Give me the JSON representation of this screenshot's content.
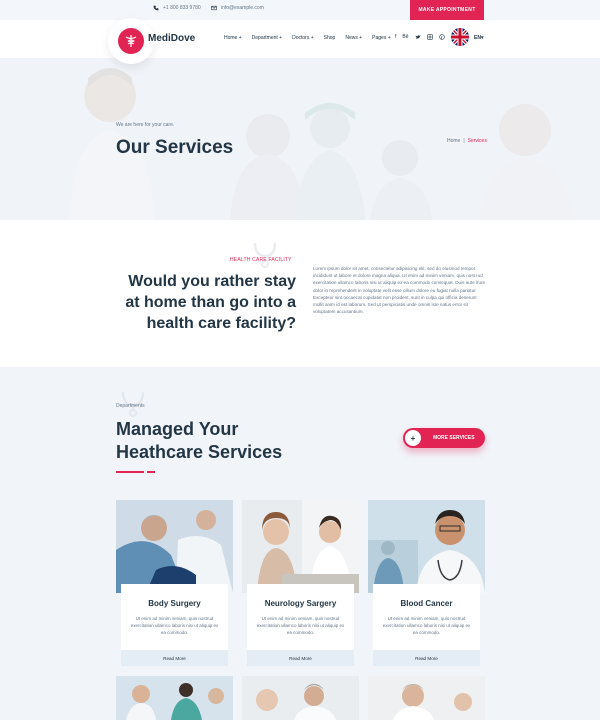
{
  "topbar": {
    "phone": "+1 800 833 9780",
    "email": "info@example.com",
    "appointment_label": "MAKE APPOINTMENT"
  },
  "header": {
    "logo_text": "MediDove",
    "nav": [
      "Home +",
      "Department +",
      "Doctors +",
      "Shop",
      "News +",
      "Pages +"
    ],
    "social_icons": [
      "facebook-icon",
      "behance-icon",
      "twitter-icon",
      "linkedin-icon",
      "pinterest-icon"
    ],
    "language": "EN▾"
  },
  "hero": {
    "tagline": "We are here for your care.",
    "title": "Our Services",
    "breadcrumb": {
      "home": "Home",
      "separator": "|",
      "current": "Services"
    }
  },
  "about": {
    "subtitle": "HEALTH CARE FACILITY",
    "heading_lines": [
      "Would you rather stay",
      "at home than go into a",
      "health care facility?"
    ],
    "body": "Lorem ipsum dolor sit amet, consectetur adipisicing elit, sed do eiusmod tempor incididunt ut labore et dolore magna aliqua. Ut enim ad minim veniam, quis nost rud exercitation ullamco laboris nisi ut aliquip ex ea commodo consequat. Duis aute irure dolor in reprehenderit in voluptate velit esse cillum dolore eu fugiat nulla pariatur. Excepteur sint occaecat cupidatat non proident, sunt in culpa qui officia deserunt mollit anim id est laborum. Sed ut perspiciatis unde omnis iste natus error sit voluptatem accusantium."
  },
  "services": {
    "label": "Departments",
    "heading_lines": [
      "Managed Your",
      "Heathcare Services"
    ],
    "more_label": "MORE SERVICES",
    "more_icon": "+",
    "cards": [
      {
        "title": "Body Surgery",
        "desc": "Ut enim ad minim veniam, quis nostrud exercitation ullamco laboris nisi ut aliquip ex ea commodo.",
        "link": "Read More"
      },
      {
        "title": "Neurology Sargery",
        "desc": "Ut enim ad minim veniam, quis nostrud exercitation ullamco laboris nisi ut aliquip ex ea commodo.",
        "link": "Read More"
      },
      {
        "title": "Blood Cancer",
        "desc": "Ut enim ad minim veniam, quis nostrud exercitation ullamco laboris nisi ut aliquip ex ea commodo.",
        "link": "Read More"
      }
    ]
  },
  "colors": {
    "accent": "#e12454",
    "heading": "#223645",
    "body": "#647589",
    "section_bg": "#f1f5fa"
  }
}
